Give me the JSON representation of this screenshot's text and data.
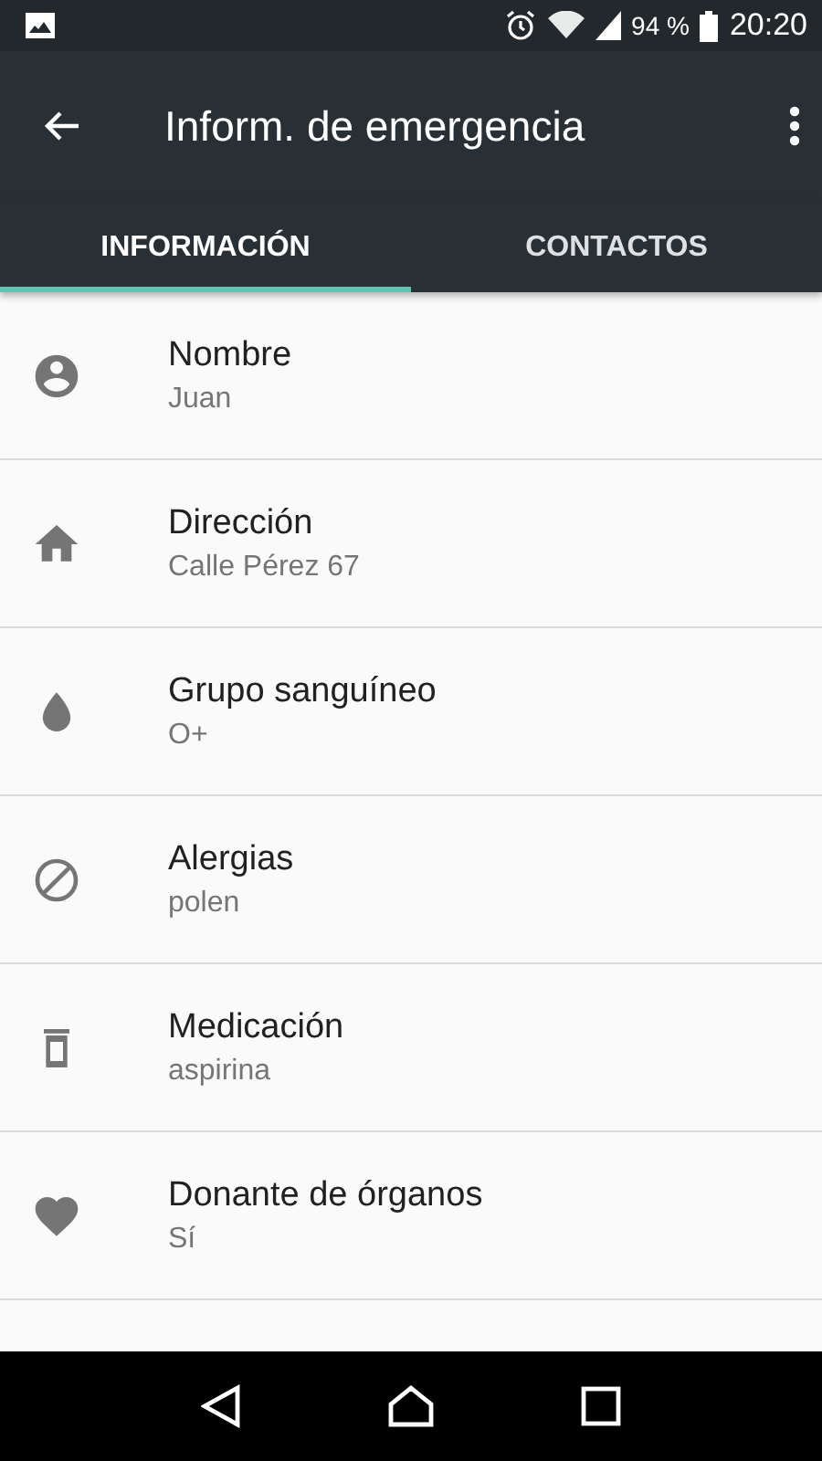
{
  "status_bar": {
    "battery": "94 %",
    "time": "20:20"
  },
  "app_bar": {
    "title": "Inform. de emergencia"
  },
  "tabs": [
    {
      "label": "INFORMACIÓN",
      "selected": true
    },
    {
      "label": "CONTACTOS",
      "selected": false
    }
  ],
  "items": [
    {
      "label": "Nombre",
      "value": "Juan"
    },
    {
      "label": "Dirección",
      "value": "Calle Pérez 67"
    },
    {
      "label": "Grupo sanguíneo",
      "value": "O+"
    },
    {
      "label": "Alergias",
      "value": "polen"
    },
    {
      "label": "Medicación",
      "value": "aspirina"
    },
    {
      "label": "Donante de órganos",
      "value": "Sí"
    }
  ]
}
